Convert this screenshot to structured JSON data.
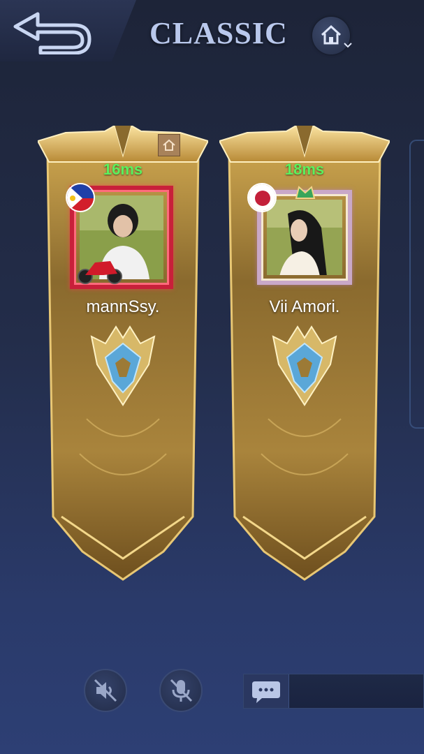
{
  "header": {
    "title": "CLASSIC"
  },
  "players": [
    {
      "name": "mannSsy.",
      "ping": "16ms",
      "flag": "philippines-flag-icon"
    },
    {
      "name": "Vii Amori.",
      "ping": "18ms",
      "flag": "japan-flag-icon"
    }
  ],
  "colors": {
    "ping": "#5bf05d",
    "title": "#b9c8ec",
    "banner_gold": "#d9b45a"
  }
}
